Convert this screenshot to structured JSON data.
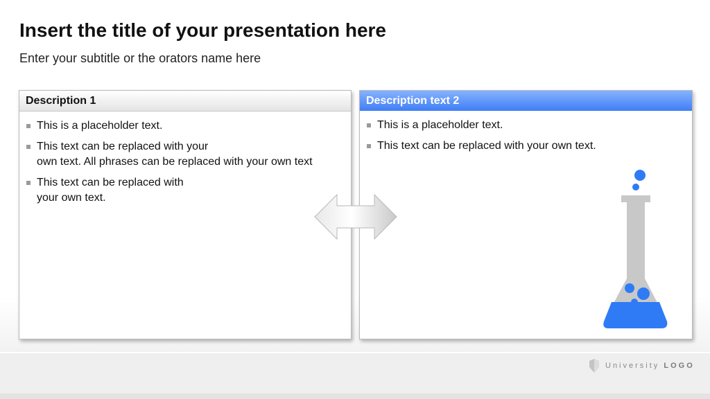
{
  "slide": {
    "title": "Insert the title of your presentation here",
    "subtitle": "Enter your subtitle or the orators name here"
  },
  "panels": [
    {
      "header": "Description 1",
      "bullets": [
        "This is a placeholder text.",
        "This text can be replaced with your\nown text. All phrases can be replaced with your own text",
        "This text can be replaced with\nyour own text."
      ]
    },
    {
      "header": "Description text 2",
      "bullets": [
        "This is a placeholder text.",
        "This text can be replaced with your own text."
      ]
    }
  ],
  "logo": {
    "word": "University",
    "mark": "LOGO"
  },
  "icons": [
    "double-arrow-icon",
    "flask-icon",
    "shield-logo-icon"
  ],
  "colors": {
    "accent_blue": "#2f7bf5",
    "header_gradient_top": "#86b2ff",
    "header_gradient_bottom": "#3f7ef6",
    "flask_gray": "#c8c8c8",
    "bullet_gray": "#9a9a9a"
  }
}
